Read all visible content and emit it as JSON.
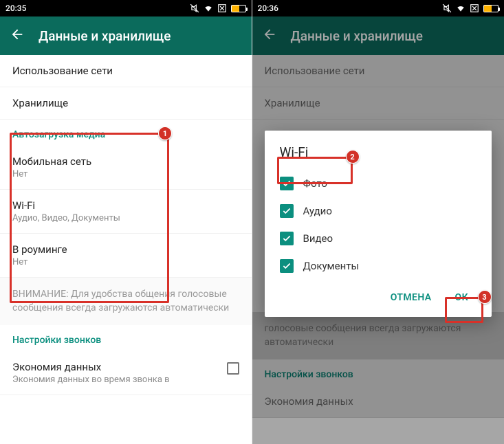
{
  "left": {
    "status_time": "20:35",
    "toolbar_title": "Данные и хранилище",
    "row_network_usage": "Использование сети",
    "row_storage": "Хранилище",
    "section_autodownload": "Автозагрузка медиа",
    "row_mobile": {
      "title": "Мобильная сеть",
      "sub": "Нет"
    },
    "row_wifi": {
      "title": "Wi-Fi",
      "sub": "Аудио, Видео, Документы"
    },
    "row_roaming": {
      "title": "В роуминге",
      "sub": "Нет"
    },
    "note": "ВНИМАНИЕ: Для удобства общения голосовые сообщения всегда загружаются автоматически",
    "section_calls": "Настройки звонков",
    "row_economy": {
      "title": "Экономия данных",
      "sub": "Экономия данных во время звонка в"
    }
  },
  "right": {
    "status_time": "20:36",
    "toolbar_title": "Данные и хранилище",
    "row_network_usage": "Использование сети",
    "row_storage": "Хранилище",
    "dialog": {
      "title": "Wi-Fi",
      "options": [
        "Фото",
        "Аудио",
        "Видео",
        "Документы"
      ],
      "cancel": "ОТМЕНА",
      "ok": "ОК"
    },
    "note": "голосовые сообщения всегда загружаются автоматически",
    "section_calls": "Настройки звонков",
    "row_economy_title": "Экономия данных"
  },
  "badges": {
    "b1": "1",
    "b2": "2",
    "b3": "3"
  }
}
